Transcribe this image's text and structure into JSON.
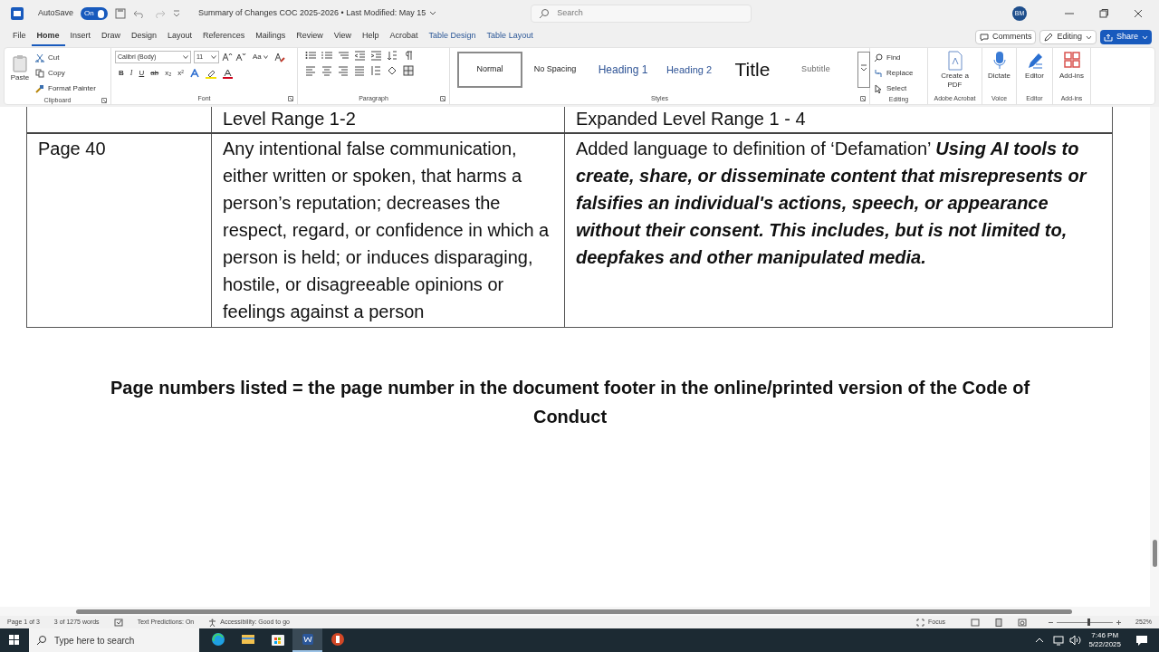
{
  "title_bar": {
    "autosave_label": "AutoSave",
    "autosave_toggle": {
      "label": "On",
      "on": true
    },
    "document_title": "Summary of Changes COC 2025-2026 • Last Modified: May 15",
    "search": {
      "placeholder": "Search"
    },
    "avatar": "BM"
  },
  "menu_tabs": [
    {
      "label": "File",
      "kind": "normal",
      "selected": false
    },
    {
      "label": "Home",
      "kind": "normal",
      "selected": true
    },
    {
      "label": "Insert",
      "kind": "normal",
      "selected": false
    },
    {
      "label": "Draw",
      "kind": "normal",
      "selected": false
    },
    {
      "label": "Design",
      "kind": "normal",
      "selected": false
    },
    {
      "label": "Layout",
      "kind": "normal",
      "selected": false
    },
    {
      "label": "References",
      "kind": "normal",
      "selected": false
    },
    {
      "label": "Mailings",
      "kind": "normal",
      "selected": false
    },
    {
      "label": "Review",
      "kind": "normal",
      "selected": false
    },
    {
      "label": "View",
      "kind": "normal",
      "selected": false
    },
    {
      "label": "Help",
      "kind": "normal",
      "selected": false
    },
    {
      "label": "Acrobat",
      "kind": "normal",
      "selected": false
    },
    {
      "label": "Table Design",
      "kind": "contextual",
      "selected": false
    },
    {
      "label": "Table Layout",
      "kind": "contextual",
      "selected": false
    }
  ],
  "header_buttons": {
    "comments": "Comments",
    "editing": "Editing",
    "share": "Share"
  },
  "ribbon": {
    "clipboard": {
      "label": "Clipboard",
      "paste": "Paste",
      "items": [
        "Cut",
        "Copy",
        "Format Painter"
      ]
    },
    "font": {
      "label": "Font",
      "font_name": "Calibri (Body)",
      "font_size": "11",
      "change_case": "Aa",
      "format_buttons": [
        "B",
        "I",
        "U",
        "ab",
        "x₂",
        "x²"
      ]
    },
    "paragraph": {
      "label": "Paragraph"
    },
    "styles": {
      "label": "Styles",
      "items": [
        {
          "label": "Normal",
          "kind": "normal",
          "selected": true
        },
        {
          "label": "No Spacing",
          "kind": "normal",
          "selected": false
        },
        {
          "label": "Heading 1",
          "kind": "heading1",
          "selected": false
        },
        {
          "label": "Heading 2",
          "kind": "heading2",
          "selected": false
        },
        {
          "label": "Title",
          "kind": "title",
          "selected": false
        },
        {
          "label": "Subtitle",
          "kind": "subtitle",
          "selected": false
        }
      ]
    },
    "editing": {
      "label": "Editing",
      "items": [
        "Find",
        "Replace",
        "Select"
      ]
    },
    "tool_groups": [
      {
        "label": "Adobe Acrobat",
        "button": "Create a PDF",
        "kind": "pdf"
      },
      {
        "label": "Voice",
        "button": "Dictate",
        "kind": "mic"
      },
      {
        "label": "Editor",
        "button": "Editor",
        "kind": "pen"
      },
      {
        "label": "Add-ins",
        "button": "Add-ins",
        "kind": "grid"
      }
    ]
  },
  "document": {
    "table": {
      "header_row": [
        "Level Range 1-2",
        "Expanded Level Range 1 - 4"
      ],
      "rows": [
        [
          "Page 40",
          "Any intentional false communication, either written or spoken, that harms a person’s reputation; decreases the respect, regard, or confidence in which a person is held; or induces disparaging, hostile, or disagreeable opinions or feelings against a person",
          "Added language to definition of ‘Defamation’ **Using AI tools to create, share, or disseminate content that misrepresents or falsifies an individual's actions, speech, or appearance without their consent. This includes, but is not limited to, deepfakes and other manipulated media.**"
        ]
      ]
    },
    "footnote": "Page numbers listed = the page number in the document footer in the online/printed version of the Code of Conduct"
  },
  "status_bar": {
    "page": "Page 1 of 3",
    "words": "3 of 1275 words",
    "text_predictions": "Text Predictions: On",
    "accessibility": "Accessibility: Good to go",
    "focus": "Focus",
    "zoom_slider": {
      "level": 0.54
    },
    "zoom": "252%"
  },
  "taskbar": {
    "search": {
      "placeholder": "Type here to search"
    },
    "apps": [
      {
        "kind": "edge",
        "selected": false
      },
      {
        "kind": "folder",
        "selected": false
      },
      {
        "kind": "store",
        "selected": false
      },
      {
        "kind": "word",
        "selected": true
      },
      {
        "kind": "powerpoint",
        "selected": false
      }
    ],
    "time": "7:46 PM",
    "date": "5/22/2025"
  }
}
